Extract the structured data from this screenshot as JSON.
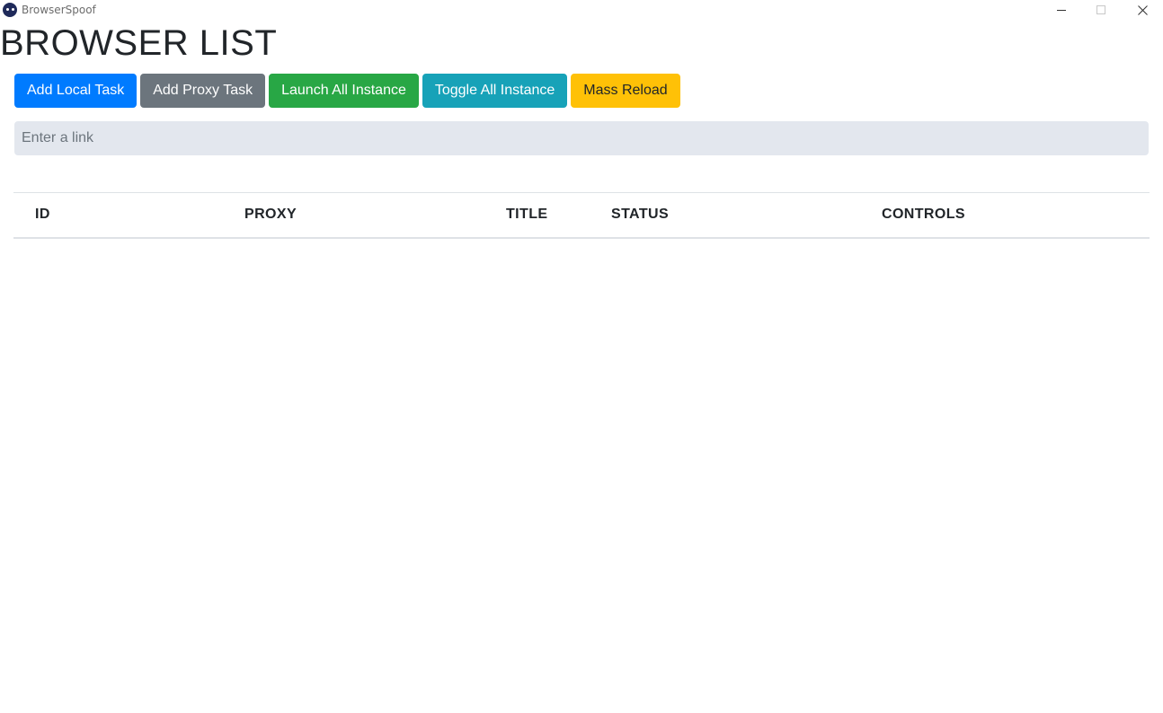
{
  "window": {
    "title": "BrowserSpoof"
  },
  "page": {
    "title": "BROWSER LIST"
  },
  "toolbar": {
    "buttons": [
      {
        "label": "Add Local Task",
        "color": "#007bff"
      },
      {
        "label": "Add Proxy Task",
        "color": "#6c757d"
      },
      {
        "label": "Launch All Instance",
        "color": "#28a745"
      },
      {
        "label": "Toggle All Instance",
        "color": "#17a2b8"
      },
      {
        "label": "Mass Reload",
        "color": "#ffc107"
      }
    ]
  },
  "link_input": {
    "value": "",
    "placeholder": "Enter a link"
  },
  "table": {
    "columns": [
      "ID",
      "PROXY",
      "TITLE",
      "STATUS",
      "CONTROLS"
    ],
    "rows": []
  },
  "icons": {
    "app": "browserspoof-logo-icon",
    "minimize": "minimize-icon",
    "maximize": "maximize-icon",
    "close": "close-icon"
  }
}
